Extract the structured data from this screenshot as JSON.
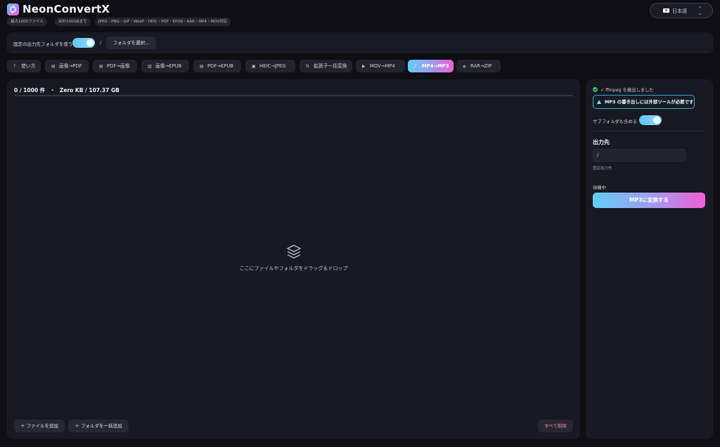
{
  "app": {
    "title": "NeonConvertX",
    "language": "日本語"
  },
  "pills": [
    "最大1000ファイル",
    "合計100GBまで",
    "JPEG・PNG・GIF・WebP・HEIC・PDF・EPUB・RAR・MP4・MOV対応"
  ],
  "output_bar": {
    "label": "固定の出力先フォルダを使う",
    "fixed_folder_enabled": true,
    "path": "/",
    "choose_button": "フォルダを選択..."
  },
  "tabs": [
    {
      "label": "使い方",
      "icon": "help-icon"
    },
    {
      "label": "画像→PDF",
      "icon": "document-icon"
    },
    {
      "label": "PDF→画像",
      "icon": "document-icon"
    },
    {
      "label": "画像→EPUB",
      "icon": "book-icon"
    },
    {
      "label": "PDF→EPUB",
      "icon": "document-icon"
    },
    {
      "label": "HEIC→JPEG",
      "icon": "image-icon"
    },
    {
      "label": "拡張子一括変換",
      "icon": "swap-icon"
    },
    {
      "label": "MOV→MP4",
      "icon": "video-icon"
    },
    {
      "label": "MP4→MP3",
      "icon": "music-note-icon",
      "active": true
    },
    {
      "label": "RAR→ZIP",
      "icon": "archive-icon"
    }
  ],
  "drop_panel": {
    "count": "0 / 1000 件",
    "separator": "・",
    "size": "Zero KB / 107.37 GB",
    "progress": 0,
    "drop_text": "ここにファイルやフォルダをドラッグ＆ドロップ",
    "add_files": "＋ ファイルを追加",
    "add_folder": "＋ フォルダを一括追加",
    "clear_all": "すべて削除"
  },
  "side_panel": {
    "detected": "✓ ffmpeg を検出しました",
    "warning": "MP3 の書き出しには外部ツールが必要です",
    "include_subfolders_label": "サブフォルダも含める",
    "include_subfolders": true,
    "output_heading": "出力先",
    "output_path": "/",
    "output_note": "固定出力先",
    "status": "待機中",
    "convert_button": "MP3に変換する"
  },
  "colors": {
    "background": "#0e0e14",
    "panel": "#181922",
    "accent_cyan": "#63cdf6",
    "accent_pink": "#f05fd3",
    "success": "#37c976",
    "danger": "#ff8a9e"
  }
}
